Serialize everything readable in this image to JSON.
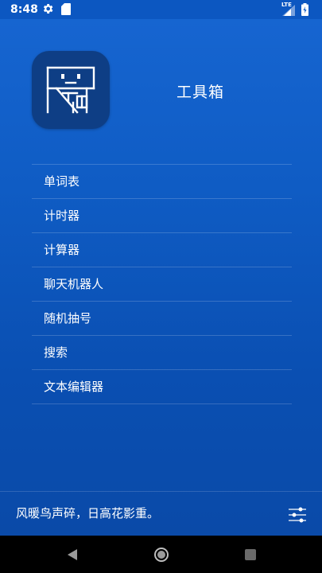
{
  "status_bar": {
    "time": "8:48",
    "network": "LTE",
    "icons": [
      "gear-icon",
      "sd-card-icon",
      "signal-icon",
      "battery-icon"
    ]
  },
  "header": {
    "title": "工具箱",
    "logo_icon": "toolbox-logo-icon",
    "logo_color": "#0e3e85"
  },
  "menu": {
    "items": [
      {
        "label": "单词表"
      },
      {
        "label": "计时器"
      },
      {
        "label": "计算器"
      },
      {
        "label": "聊天机器人"
      },
      {
        "label": "随机抽号"
      },
      {
        "label": "搜索"
      },
      {
        "label": "文本编辑器"
      }
    ]
  },
  "footer": {
    "quote": "风暖鸟声碎，日高花影重。",
    "settings_icon": "sliders-icon"
  },
  "nav_bar": {
    "icons": [
      "back-icon",
      "home-icon",
      "recents-icon"
    ]
  },
  "colors": {
    "background_top": "#1766d2",
    "background_bottom": "#0a4aa8",
    "text": "#ffffff"
  }
}
